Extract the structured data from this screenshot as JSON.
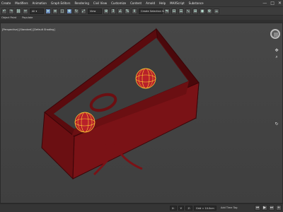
{
  "menubar": {
    "items": [
      "Create",
      "Modifiers",
      "Animation",
      "Graph Editors",
      "Rendering",
      "Civil View",
      "Customize",
      "Content",
      "Arnold",
      "Help",
      "MAXScript",
      "Substance"
    ],
    "window_controls": [
      "—",
      "□",
      "✕"
    ]
  },
  "toolbar": {
    "selection_set_placeholder": "Create Selection Se",
    "view_dropdown": "View"
  },
  "ribbon": {
    "tabs": [
      "Object Paint",
      "Populate"
    ]
  },
  "viewport": {
    "label": "[Perspective] [Standard] [Default Shading]",
    "shading": "perspective",
    "colors": {
      "box": "#6b0f12",
      "box_dark": "#4a080b",
      "wire": "#ffcc33",
      "sphere": "#b8202a"
    }
  },
  "statusbar": {
    "left_text": "",
    "coords": {
      "x": "X:",
      "y": "Y:",
      "z": "Z:",
      "grid": "Grid = 10.0cm"
    },
    "add_tag": "Add Time Tag",
    "buttons": [
      "⏮",
      "▶",
      "⏭",
      "+"
    ]
  },
  "icons": [
    "select-icon",
    "move-icon",
    "rotate-icon",
    "scale-icon",
    "snap-icon",
    "mirror-icon",
    "align-icon",
    "render-icon"
  ]
}
